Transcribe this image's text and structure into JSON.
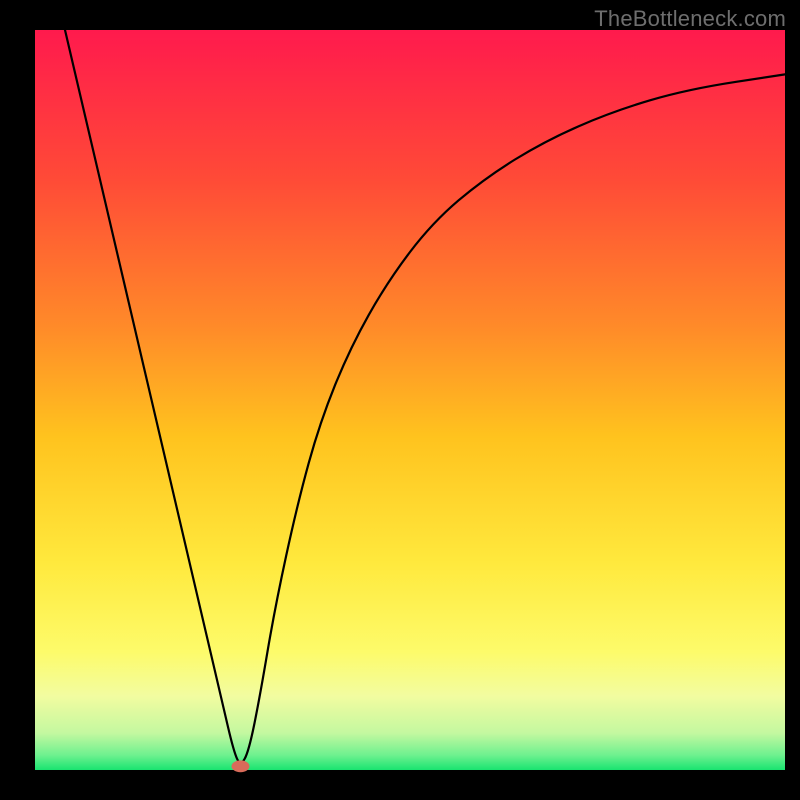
{
  "watermark": "TheBottleneck.com",
  "chart_data": {
    "type": "line",
    "title": "",
    "xlabel": "",
    "ylabel": "",
    "xlim": [
      0,
      100
    ],
    "ylim": [
      0,
      100
    ],
    "gradient": {
      "direction": "vertical",
      "stops": [
        {
          "pos": 0.0,
          "color": "#ff1a4d"
        },
        {
          "pos": 0.2,
          "color": "#ff4a37"
        },
        {
          "pos": 0.4,
          "color": "#ff8a29"
        },
        {
          "pos": 0.55,
          "color": "#ffc31e"
        },
        {
          "pos": 0.72,
          "color": "#ffe93d"
        },
        {
          "pos": 0.84,
          "color": "#fdfb6a"
        },
        {
          "pos": 0.9,
          "color": "#f2fca0"
        },
        {
          "pos": 0.95,
          "color": "#c4f8a0"
        },
        {
          "pos": 0.98,
          "color": "#6ef18f"
        },
        {
          "pos": 1.0,
          "color": "#19e470"
        }
      ]
    },
    "series": [
      {
        "name": "bottleneck-curve",
        "color": "#000000",
        "points": [
          {
            "x": 4,
            "y": 100
          },
          {
            "x": 7,
            "y": 87
          },
          {
            "x": 10,
            "y": 74
          },
          {
            "x": 13,
            "y": 61
          },
          {
            "x": 16,
            "y": 48
          },
          {
            "x": 19,
            "y": 35
          },
          {
            "x": 22,
            "y": 22
          },
          {
            "x": 25,
            "y": 9
          },
          {
            "x": 26.5,
            "y": 2.5
          },
          {
            "x": 27.4,
            "y": 0.5
          },
          {
            "x": 28.5,
            "y": 2.5
          },
          {
            "x": 30,
            "y": 10
          },
          {
            "x": 32,
            "y": 22
          },
          {
            "x": 35,
            "y": 36
          },
          {
            "x": 38,
            "y": 47
          },
          {
            "x": 42,
            "y": 57
          },
          {
            "x": 47,
            "y": 66
          },
          {
            "x": 53,
            "y": 74
          },
          {
            "x": 60,
            "y": 80
          },
          {
            "x": 68,
            "y": 85
          },
          {
            "x": 77,
            "y": 89
          },
          {
            "x": 87,
            "y": 92
          },
          {
            "x": 100,
            "y": 94
          }
        ]
      }
    ],
    "marker": {
      "x": 27.4,
      "y": 0.5,
      "rx": 1.2,
      "ry": 0.8,
      "color": "#d96b5a"
    }
  }
}
